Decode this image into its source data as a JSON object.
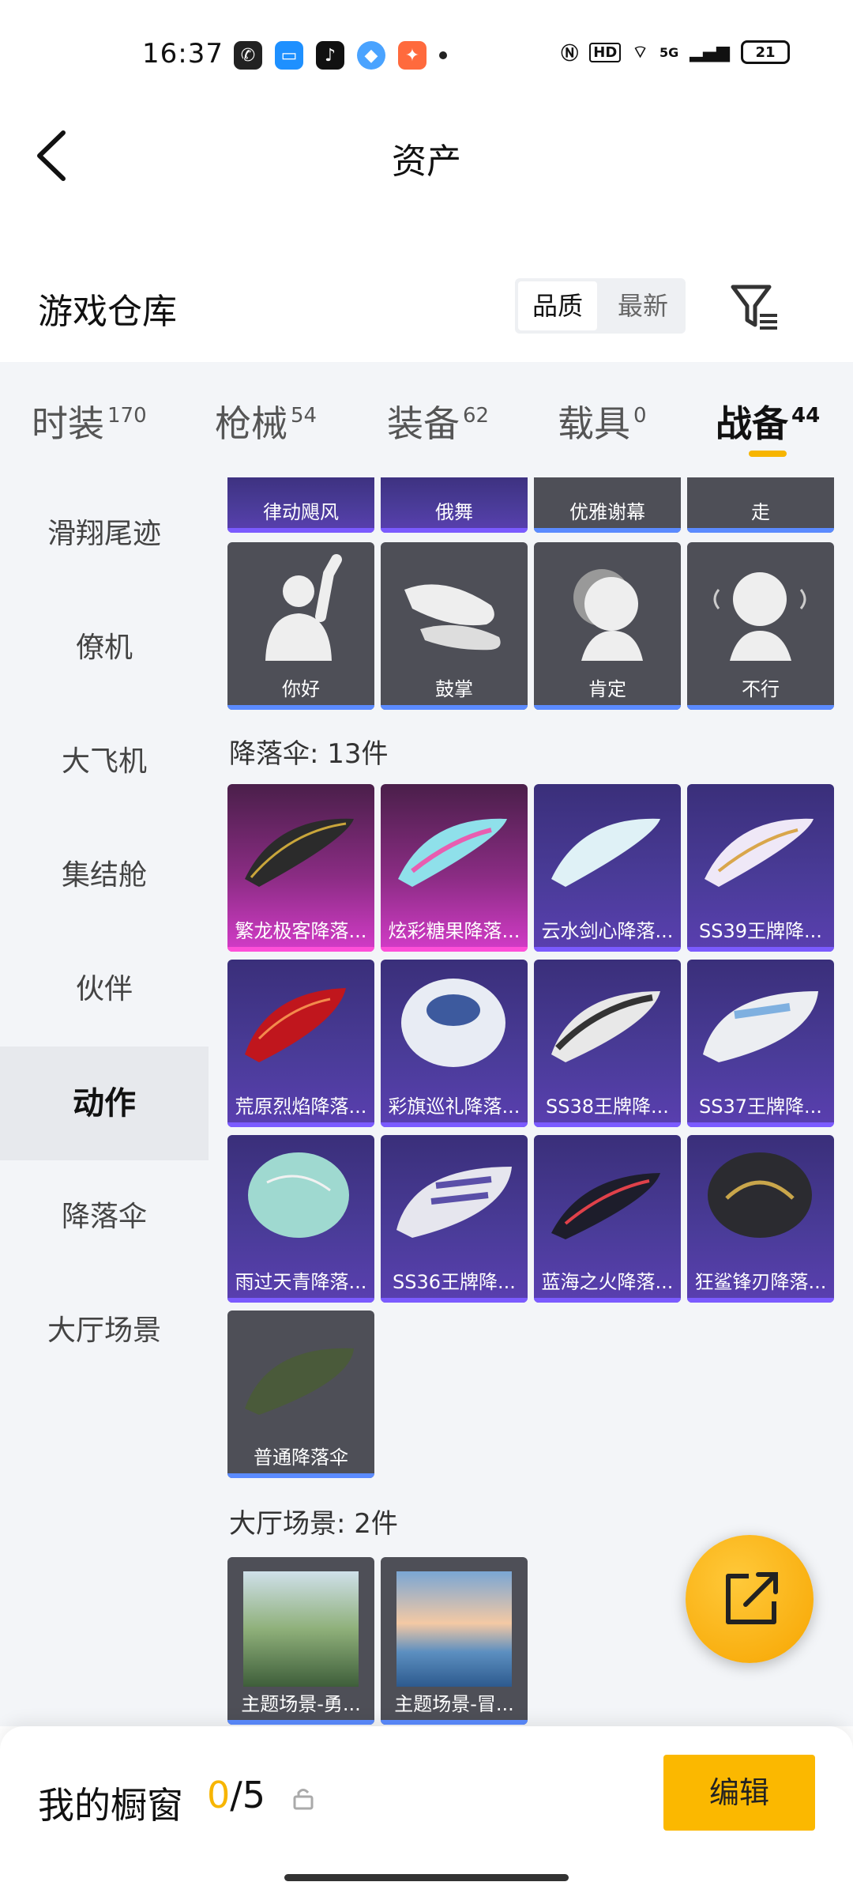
{
  "status_bar": {
    "time": "16:37",
    "network": "5G",
    "hd": "HD",
    "battery": "21"
  },
  "header": {
    "title": "资产"
  },
  "section": {
    "title": "游戏仓库"
  },
  "sort": {
    "quality": "品质",
    "newest": "最新"
  },
  "tabs": [
    {
      "label": "时装",
      "count": "170"
    },
    {
      "label": "枪械",
      "count": "54"
    },
    {
      "label": "装备",
      "count": "62"
    },
    {
      "label": "载具",
      "count": "0"
    },
    {
      "label": "战备",
      "count": "44"
    }
  ],
  "sidebar": [
    {
      "label": "滑翔尾迹"
    },
    {
      "label": "僚机"
    },
    {
      "label": "大飞机"
    },
    {
      "label": "集结舱"
    },
    {
      "label": "伙伴"
    },
    {
      "label": "动作"
    },
    {
      "label": "降落伞"
    },
    {
      "label": "大厅场景"
    }
  ],
  "actions_row1": [
    {
      "label": "律动飓风"
    },
    {
      "label": "俄舞"
    },
    {
      "label": "优雅谢幕"
    },
    {
      "label": "走"
    }
  ],
  "actions_row2": [
    {
      "label": "你好"
    },
    {
      "label": "鼓掌"
    },
    {
      "label": "肯定"
    },
    {
      "label": "不行"
    }
  ],
  "parachute_header": "降落伞: 13件",
  "parachutes": [
    {
      "label": "繁龙极客降落..."
    },
    {
      "label": "炫彩糖果降落..."
    },
    {
      "label": "云水剑心降落..."
    },
    {
      "label": "SS39王牌降..."
    },
    {
      "label": "荒原烈焰降落..."
    },
    {
      "label": "彩旗巡礼降落..."
    },
    {
      "label": "SS38王牌降..."
    },
    {
      "label": "SS37王牌降..."
    },
    {
      "label": "雨过天青降落..."
    },
    {
      "label": "SS36王牌降..."
    },
    {
      "label": "蓝海之火降落..."
    },
    {
      "label": "狂鲨锋刃降落..."
    },
    {
      "label": "普通降落伞"
    }
  ],
  "lobby_header": "大厅场景: 2件",
  "lobby": [
    {
      "label": "主题场景-勇..."
    },
    {
      "label": "主题场景-冒..."
    }
  ],
  "bottom": {
    "label": "我的橱窗",
    "used": "0",
    "total": "/5",
    "edit": "编辑"
  },
  "colors": {
    "accent": "#f7b500",
    "tile_dark": "#4e4f57",
    "tile_purple": "#4b3c9a",
    "tile_pink": "#d43cc9"
  }
}
